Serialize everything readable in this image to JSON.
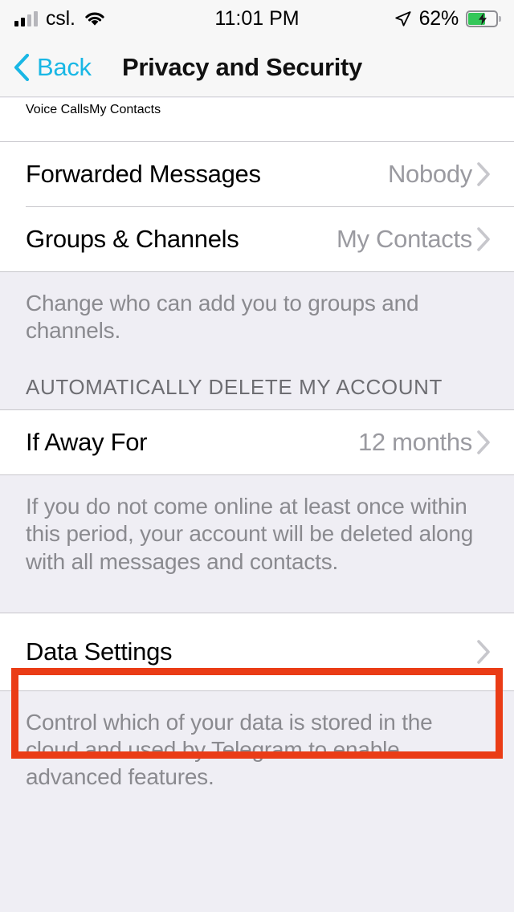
{
  "status_bar": {
    "carrier": "csl.",
    "time": "11:01 PM",
    "battery_percent": "62%",
    "battery_level": 62,
    "signal_icon": "cellular-bars-icon",
    "wifi_icon": "wifi-icon",
    "location_icon": "location-arrow-icon",
    "battery_icon": "battery-charging-icon"
  },
  "nav": {
    "back_label": "Back",
    "back_icon": "chevron-left-icon",
    "title": "Privacy and Security"
  },
  "colors": {
    "accent": "#19B7E5",
    "highlight": "#EA3C16",
    "background": "#EFEEF4",
    "cell": "#FFFFFF",
    "separator": "#C8C7CC",
    "value_text": "#9A9AA0",
    "footer_text": "#8A8A8F",
    "battery_green": "#34C759"
  },
  "sections": [
    {
      "name": "privacy-rows",
      "rows": [
        {
          "title": "Voice Calls",
          "value": "My Contacts",
          "clipped": true
        },
        {
          "title": "Forwarded Messages",
          "value": "Nobody",
          "clipped": false
        },
        {
          "title": "Groups & Channels",
          "value": "My Contacts",
          "clipped": false
        }
      ],
      "footer": "Change who can add you to groups and channels."
    },
    {
      "name": "auto-delete",
      "header": "AUTOMATICALLY DELETE MY ACCOUNT",
      "rows": [
        {
          "title": "If Away For",
          "value": "12 months",
          "clipped": false
        }
      ],
      "footer": "If you do not come online at least once within this period, your account will be deleted along with all messages and contacts."
    },
    {
      "name": "data-settings",
      "rows": [
        {
          "title": "Data Settings",
          "value": "",
          "clipped": false,
          "highlighted": true
        }
      ],
      "footer": "Control which of your data is stored in the cloud and used by Telegram to enable advanced features."
    }
  ]
}
